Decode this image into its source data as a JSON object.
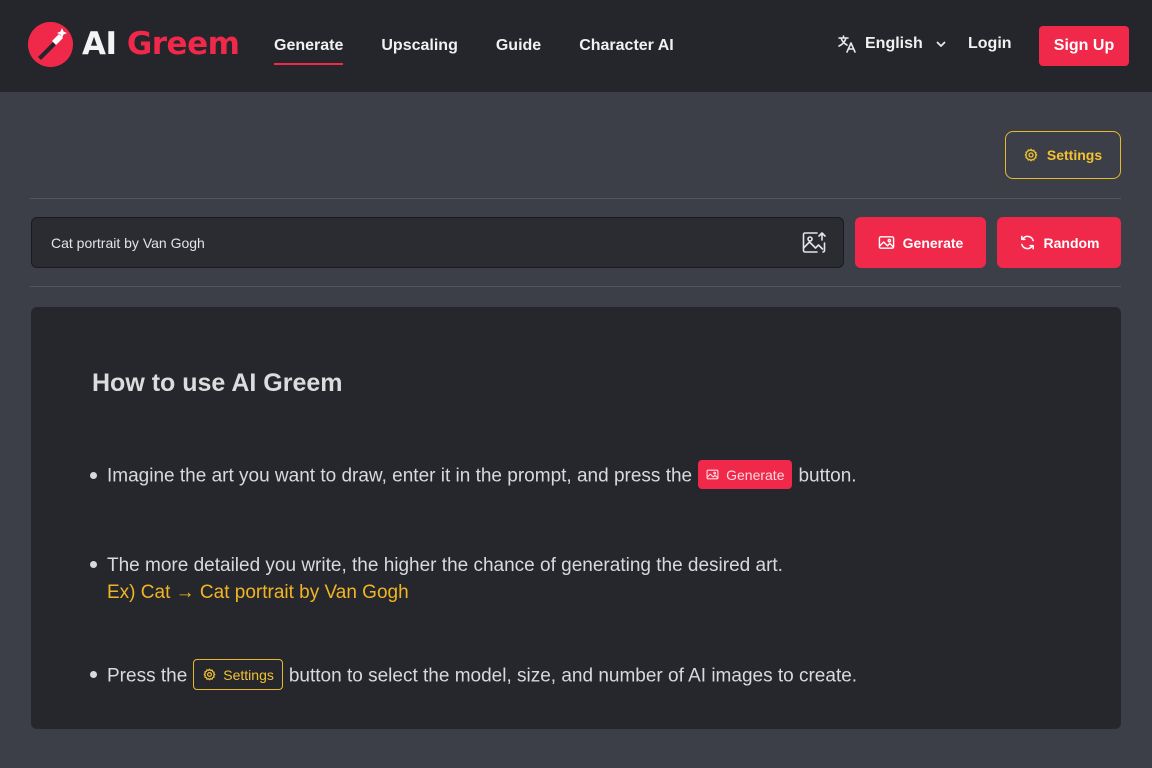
{
  "header": {
    "brand_ai": "AI",
    "brand_greem": "Greem",
    "nav": [
      {
        "label": "Generate",
        "active": true
      },
      {
        "label": "Upscaling",
        "active": false
      },
      {
        "label": "Guide",
        "active": false
      },
      {
        "label": "Character AI",
        "active": false
      }
    ],
    "language": "English",
    "login": "Login",
    "signup": "Sign Up"
  },
  "toolbar": {
    "settings_label": "Settings",
    "prompt_value": "Cat portrait by Van Gogh",
    "generate_label": "Generate",
    "random_label": "Random"
  },
  "guide": {
    "title": "How to use AI Greem",
    "item1_before": "Imagine the art you want to draw, enter it in the prompt, and press the",
    "item1_button": "Generate",
    "item1_after": "button.",
    "item2_text": "The more detailed you write, the higher the chance of generating the desired art.",
    "item2_example": "Ex) Cat → Cat portrait by Van Gogh",
    "item3_before": "Press the",
    "item3_button": "Settings",
    "item3_after": "button to select the model, size, and number of AI images to create."
  },
  "colors": {
    "brand": "#f0284a",
    "accent_gold": "#f2c232",
    "background": "#3c3f47",
    "header": "#24262b",
    "card": "#25272c"
  },
  "icons": {
    "logo": "brush-sparkle-icon",
    "language": "translate-icon",
    "chevron": "chevron-down-icon",
    "settings": "gear-icon",
    "prompt": "image-upload-icon",
    "generate": "image-icon",
    "random": "refresh-icon"
  }
}
